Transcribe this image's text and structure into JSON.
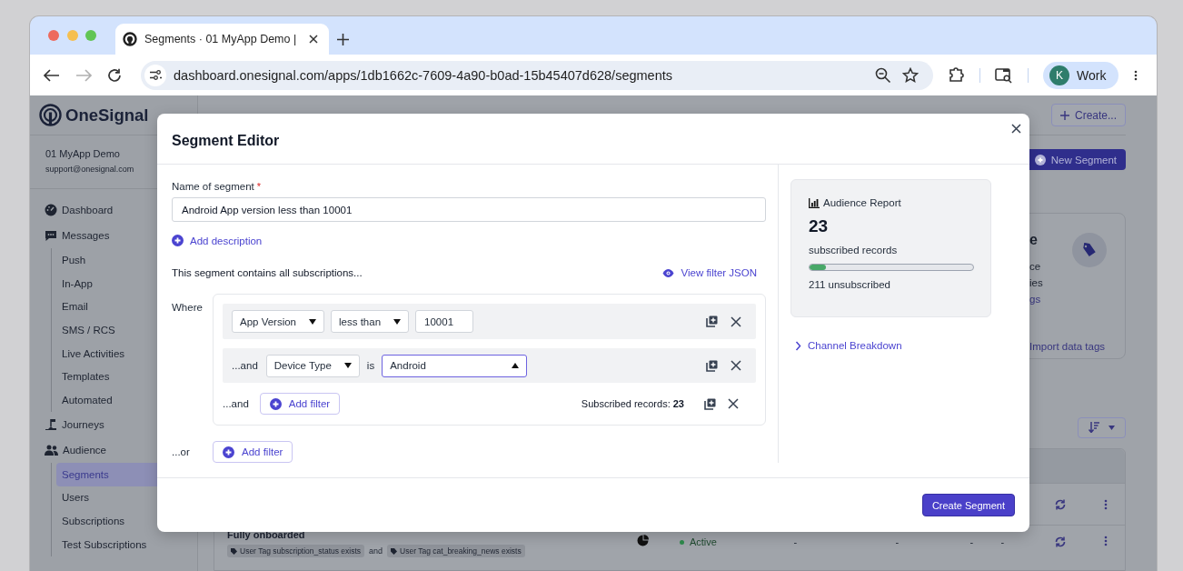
{
  "browser": {
    "tab": {
      "title": "Segments · 01 MyApp Demo |",
      "selected": true
    },
    "back_disabled": false,
    "forward_disabled": true,
    "url": "dashboard.onesignal.com/apps/1db1662c-7609-4a90-b0ad-15b45407d628/segments",
    "profile": {
      "initial": "K",
      "label": "Work"
    }
  },
  "sidebar": {
    "logo": "OneSignal",
    "app_name": "01 MyApp Demo",
    "account": "support@onesignal.com",
    "items": [
      {
        "label": "Dashboard",
        "selected": false
      },
      {
        "label": "Messages",
        "selected": false,
        "children": [
          {
            "label": "Push",
            "selected": false
          },
          {
            "label": "In-App",
            "selected": false
          },
          {
            "label": "Email",
            "selected": false
          },
          {
            "label": "SMS / RCS",
            "selected": false
          },
          {
            "label": "Live Activities",
            "selected": false
          },
          {
            "label": "Templates",
            "selected": false
          },
          {
            "label": "Automated",
            "selected": false
          }
        ]
      },
      {
        "label": "Journeys",
        "selected": false
      },
      {
        "label": "Audience",
        "selected": false,
        "children": [
          {
            "label": "Segments",
            "selected": true
          },
          {
            "label": "Users",
            "selected": false
          },
          {
            "label": "Subscriptions",
            "selected": false
          },
          {
            "label": "Test Subscriptions",
            "selected": false
          }
        ]
      }
    ]
  },
  "page": {
    "create_button": "Create...",
    "new_segment_button": "New Segment",
    "card": {
      "title_fragment": "e",
      "lines": [
        "ce",
        "ies"
      ],
      "link_fragment": "gs",
      "link": "Import data tags"
    },
    "table": {
      "rows": [
        {
          "kind": "covered"
        },
        {
          "kind": "segment",
          "name": "Fully onboarded",
          "tags": [
            "User Tag subscription_status exists",
            "User Tag cat_breaking_news exists"
          ],
          "tag_joiner": "and",
          "status": "Active",
          "cells": [
            "-",
            "-",
            "-",
            "-"
          ]
        }
      ]
    }
  },
  "modal": {
    "title": "Segment Editor",
    "name_field": {
      "label": "Name of segment",
      "required_mark": "*",
      "value": "Android App version less than 10001"
    },
    "add_description": "Add description",
    "summary": "This segment contains all subscriptions...",
    "view_json": "View filter JSON",
    "where_label": "Where",
    "filters": [
      {
        "fields": [
          {
            "kind": "select",
            "value": "App Version",
            "open": false
          },
          {
            "kind": "select",
            "value": "less than",
            "open": false
          },
          {
            "kind": "input",
            "value": "10001"
          }
        ]
      },
      {
        "conjunction": "...and",
        "fields": [
          {
            "kind": "select",
            "value": "Device Type",
            "open": false
          },
          {
            "kind": "text",
            "value": "is"
          },
          {
            "kind": "value_select",
            "value": "Android",
            "open": true
          }
        ]
      }
    ],
    "and_row": {
      "conjunction": "...and",
      "add_filter": "Add filter",
      "records": "Subscribed records: **23**"
    },
    "or_row": {
      "conjunction": "...or",
      "add_filter": "Add filter"
    },
    "report": {
      "title": "Audience Report",
      "count": "23",
      "count_label": "subscribed records",
      "level": 0.098,
      "unsubscribed": "211 unsubscribed"
    },
    "channel_breakdown": {
      "label": "Channel Breakdown",
      "expanded": false
    },
    "primary_button": "Create Segment"
  }
}
